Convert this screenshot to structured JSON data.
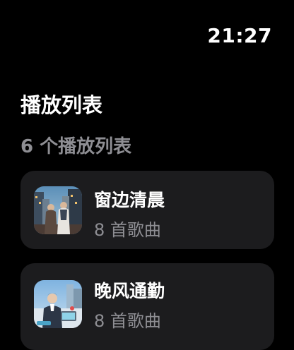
{
  "status_bar": {
    "time": "21:27"
  },
  "header": {
    "title": "播放列表",
    "count_label": "6 个播放列表"
  },
  "playlists": [
    {
      "title": "窗边清晨",
      "subtitle": "8 首歌曲",
      "artwork_icon": "city-couple-artwork"
    },
    {
      "title": "晚风通勤",
      "subtitle": "8 首歌曲",
      "artwork_icon": "office-worker-artwork"
    }
  ],
  "colors": {
    "background": "#000000",
    "card": "#1c1c1e",
    "secondary_text": "#8e8e93"
  }
}
